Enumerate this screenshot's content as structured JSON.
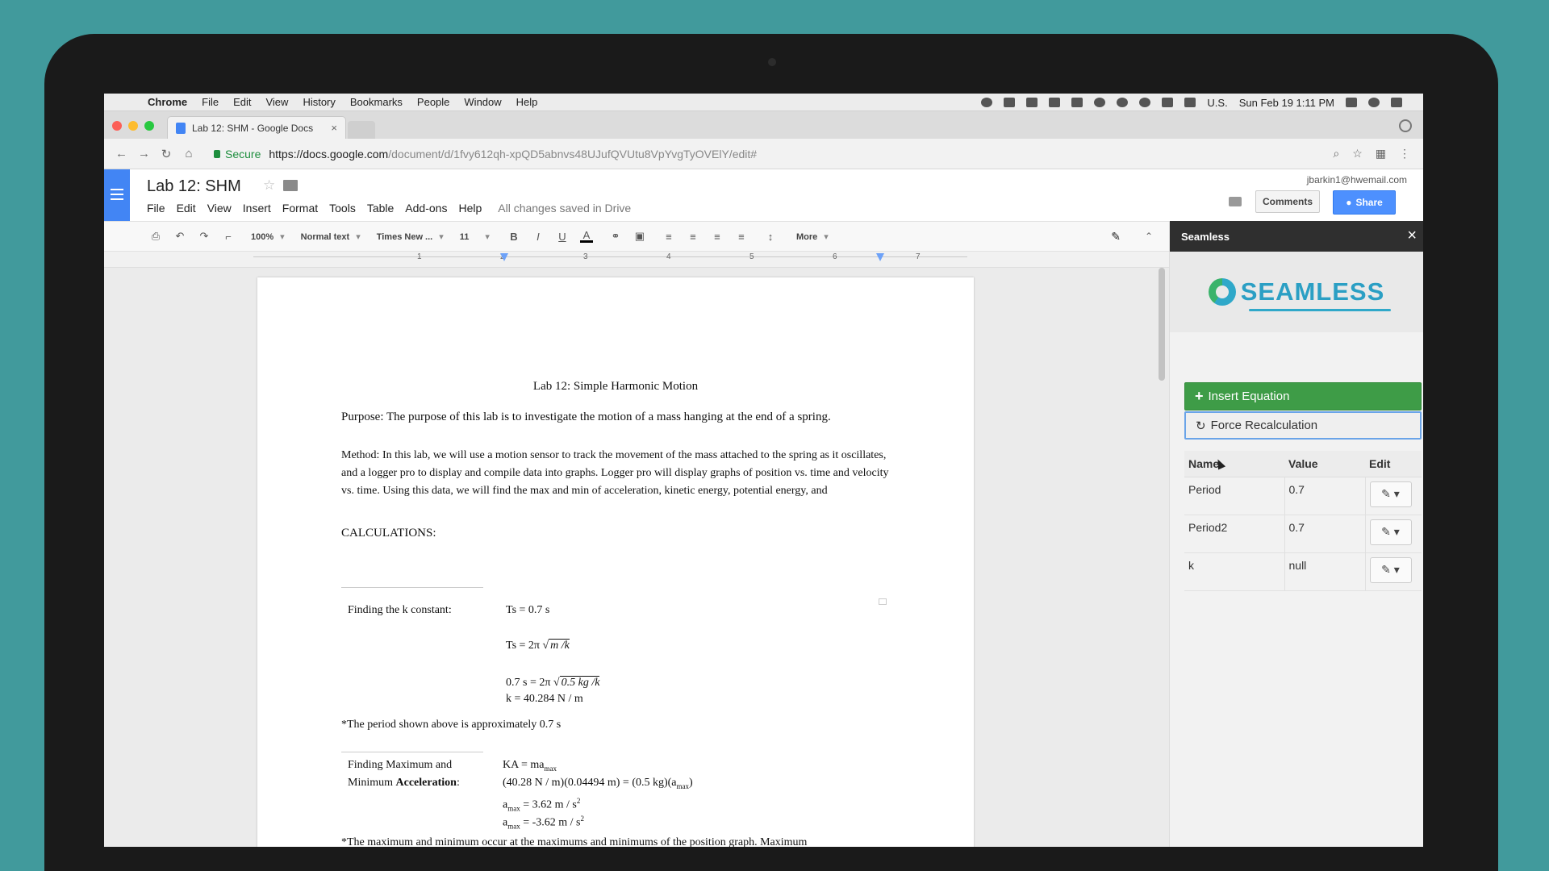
{
  "menubar": {
    "app": "Chrome",
    "items": [
      "File",
      "Edit",
      "View",
      "History",
      "Bookmarks",
      "People",
      "Window",
      "Help"
    ],
    "locale": "U.S.",
    "datetime": "Sun Feb 19  1:11 PM"
  },
  "tab": {
    "title": "Lab 12: SHM - Google Docs"
  },
  "address": {
    "secure_label": "Secure",
    "url_host": "https://docs.google.com",
    "url_path": "/document/d/1fvy612qh-xpQD5abnvs48UJufQVUtu8VpYvgTyOVElY/edit#"
  },
  "docs": {
    "title": "Lab 12: SHM",
    "menu": [
      "File",
      "Edit",
      "View",
      "Insert",
      "Format",
      "Tools",
      "Table",
      "Add-ons",
      "Help"
    ],
    "saved_status": "All changes saved in Drive",
    "account": "jbarkin1@hwemail.com",
    "comments_label": "Comments",
    "share_label": "Share"
  },
  "toolbar": {
    "zoom": "100%",
    "style": "Normal text",
    "font": "Times New ...",
    "size": "11",
    "more": "More"
  },
  "ruler": {
    "numbers": [
      "1",
      "2",
      "3",
      "4",
      "5",
      "6",
      "7"
    ]
  },
  "document": {
    "heading": "Lab 12: Simple Harmonic Motion",
    "purpose": "Purpose: The purpose of this lab is to investigate the motion of a mass hanging at the end of a spring.",
    "method": "Method: In this lab, we will use a motion sensor to track the movement of the mass attached to the spring as it oscillates, and a logger pro to display and compile data into graphs. Logger pro will display graphs of position vs. time and velocity vs. time. Using this data, we will find the max and min of acceleration, kinetic energy, potential energy, and",
    "calc_heading": "CALCULATIONS:",
    "k_label": "Finding the k constant:",
    "ts_value": "Ts = 0.7 s",
    "ts_formula_left": "Ts = 2π √",
    "ts_formula_root": "m /k",
    "ts_sub_left": "0.7 s = 2π √",
    "ts_sub_root": "0.5 kg /k",
    "k_value": "k = 40.284 N / m",
    "period_note": "*The period shown above is approximately 0.7 s",
    "acc_label_1": "Finding Maximum and",
    "acc_label_2a": "Minimum ",
    "acc_label_2b": "Acceleration",
    "acc_label_2c": ":",
    "acc_eq1": "KA = ma",
    "acc_eq1_sub": "max",
    "acc_eq2": "(40.28 N / m)(0.04494 m) = (0.5 kg)(a",
    "acc_eq2_sub": "max",
    "acc_eq2_end": ")",
    "amax_a": "a",
    "amax_sub": "max",
    "amax_rest": " = 3.62 m / s",
    "amax_sup": "2",
    "amin_a": "a",
    "amin_sub": "max",
    "amin_rest": " = -3.62 m / s",
    "amin_sup": "2",
    "cut_line": "*The maximum and minimum occur at the maximums and minimums of the position graph. Maximum"
  },
  "sidebar": {
    "title": "Seamless",
    "logo_text": "SEAMLESS",
    "insert_label": "Insert Equation",
    "force_label": "Force Recalculation",
    "columns": [
      "Name",
      "Value",
      "Edit"
    ],
    "rows": [
      {
        "name": "Period",
        "value": "0.7"
      },
      {
        "name": "Period2",
        "value": "0.7"
      },
      {
        "name": "k",
        "value": "null"
      }
    ]
  },
  "colors": {
    "docs_blue": "#4285f4",
    "seamless_green": "#3e9c47",
    "seamless_blue": "#2b9fc4",
    "share_blue": "#4d90fe"
  }
}
